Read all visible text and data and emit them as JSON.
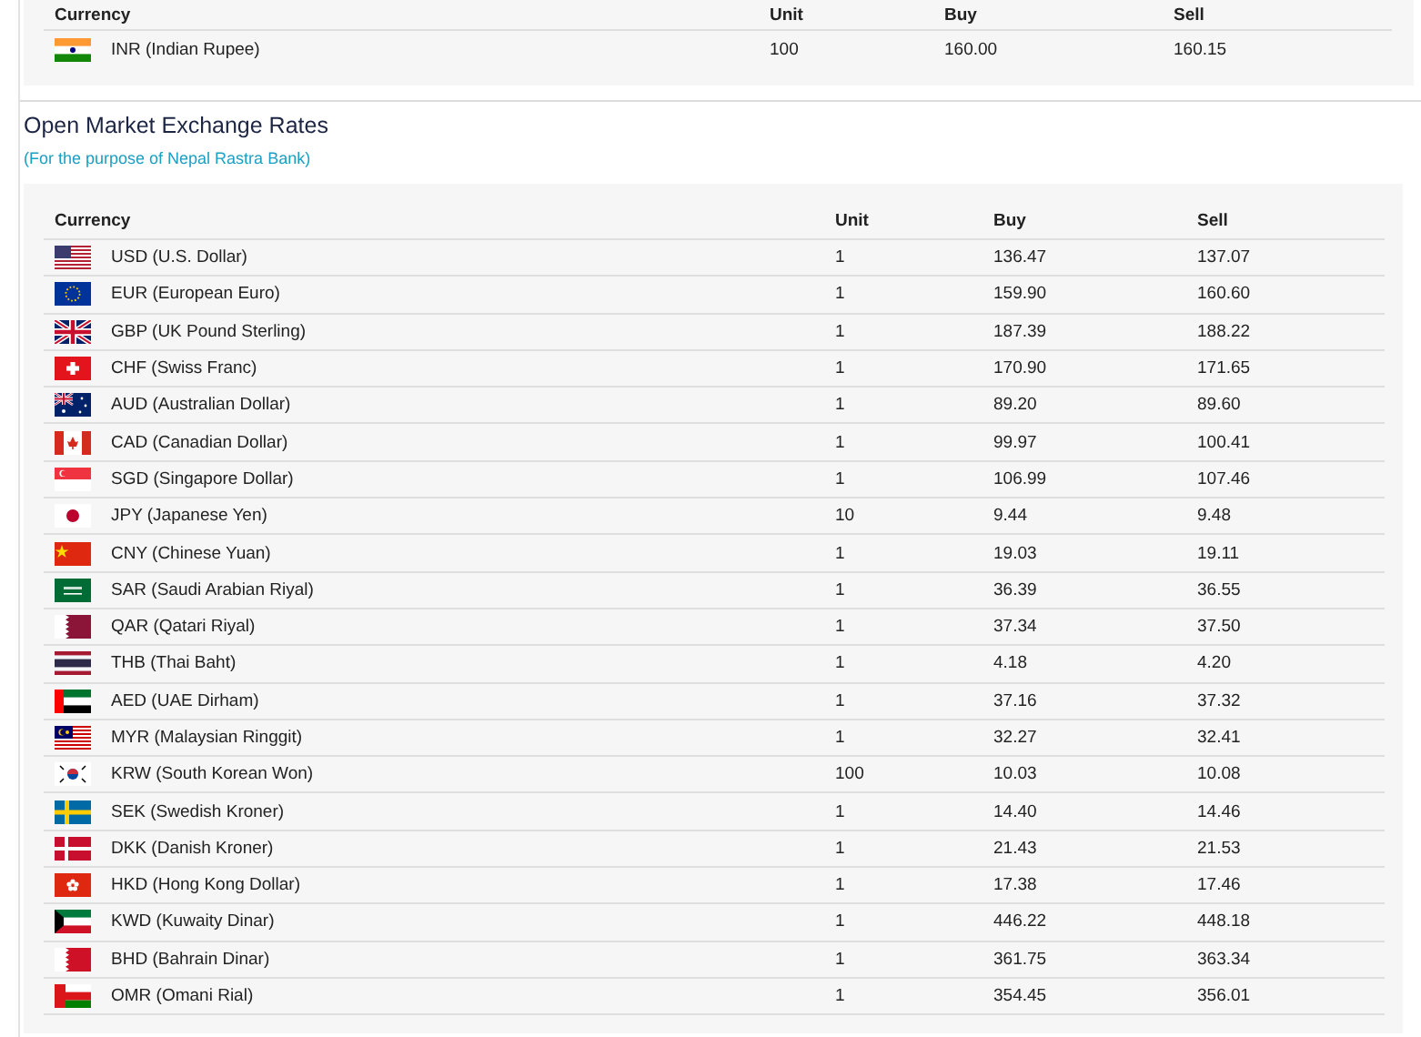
{
  "rates_table": {
    "columns": [
      "Currency",
      "Unit",
      "Buy",
      "Sell"
    ],
    "rows": [
      {
        "currency": "INR (Indian Rupee)",
        "unit": "100",
        "buy": "160.00",
        "sell": "160.15"
      }
    ]
  },
  "open_market": {
    "title": "Open Market Exchange Rates",
    "subtitle": "(For the purpose of Nepal Rastra Bank)",
    "columns": [
      "Currency",
      "Unit",
      "Buy",
      "Sell"
    ],
    "rows": [
      {
        "currency": "USD (U.S. Dollar)",
        "unit": "1",
        "buy": "136.47",
        "sell": "137.07"
      },
      {
        "currency": "EUR (European Euro)",
        "unit": "1",
        "buy": "159.90",
        "sell": "160.60"
      },
      {
        "currency": "GBP (UK Pound Sterling)",
        "unit": "1",
        "buy": "187.39",
        "sell": "188.22"
      },
      {
        "currency": "CHF (Swiss Franc)",
        "unit": "1",
        "buy": "170.90",
        "sell": "171.65"
      },
      {
        "currency": "AUD (Australian Dollar)",
        "unit": "1",
        "buy": "89.20",
        "sell": "89.60"
      },
      {
        "currency": "CAD (Canadian Dollar)",
        "unit": "1",
        "buy": "99.97",
        "sell": "100.41"
      },
      {
        "currency": "SGD (Singapore Dollar)",
        "unit": "1",
        "buy": "106.99",
        "sell": "107.46"
      },
      {
        "currency": "JPY (Japanese Yen)",
        "unit": "10",
        "buy": "9.44",
        "sell": "9.48"
      },
      {
        "currency": "CNY (Chinese Yuan)",
        "unit": "1",
        "buy": "19.03",
        "sell": "19.11"
      },
      {
        "currency": "SAR (Saudi Arabian Riyal)",
        "unit": "1",
        "buy": "36.39",
        "sell": "36.55"
      },
      {
        "currency": "QAR (Qatari Riyal)",
        "unit": "1",
        "buy": "37.34",
        "sell": "37.50"
      },
      {
        "currency": "THB (Thai Baht)",
        "unit": "1",
        "buy": "4.18",
        "sell": "4.20"
      },
      {
        "currency": "AED (UAE Dirham)",
        "unit": "1",
        "buy": "37.16",
        "sell": "37.32"
      },
      {
        "currency": "MYR (Malaysian Ringgit)",
        "unit": "1",
        "buy": "32.27",
        "sell": "32.41"
      },
      {
        "currency": "KRW (South Korean Won)",
        "unit": "100",
        "buy": "10.03",
        "sell": "10.08"
      },
      {
        "currency": "SEK (Swedish Kroner)",
        "unit": "1",
        "buy": "14.40",
        "sell": "14.46"
      },
      {
        "currency": "DKK (Danish Kroner)",
        "unit": "1",
        "buy": "21.43",
        "sell": "21.53"
      },
      {
        "currency": "HKD (Hong Kong Dollar)",
        "unit": "1",
        "buy": "17.38",
        "sell": "17.46"
      },
      {
        "currency": "KWD (Kuwaity Dinar)",
        "unit": "1",
        "buy": "446.22",
        "sell": "448.18"
      },
      {
        "currency": "BHD (Bahrain Dinar)",
        "unit": "1",
        "buy": "361.75",
        "sell": "363.34"
      },
      {
        "currency": "OMR (Omani Rial)",
        "unit": "1",
        "buy": "354.45",
        "sell": "356.01"
      }
    ]
  }
}
